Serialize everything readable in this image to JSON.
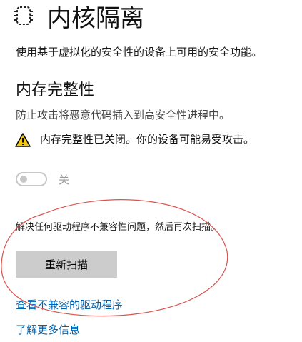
{
  "header": {
    "icon": "memory-chip-icon",
    "title": "内核隔离",
    "description": "使用基于虚拟化的安全性的设备上可用的安全功能。"
  },
  "memory_integrity": {
    "title": "内存完整性",
    "description": "防止攻击将恶意代码插入到高安全性进程中。",
    "warning": {
      "icon": "warning-icon",
      "text": "内存完整性已关闭。你的设备可能易受攻击。",
      "color": "#f2c811"
    },
    "toggle": {
      "state": "off",
      "label": "关"
    },
    "rescan_description": "解决任何驱动程序不兼容性问题，然后再次扫描。",
    "rescan_button": "重新扫描"
  },
  "links": {
    "incompatible_drivers": "查看不兼容的驱动程序",
    "learn_more": "了解更多信息"
  },
  "colors": {
    "link": "#0063b1",
    "button_bg": "#cccccc",
    "annotation": "#d9534f"
  }
}
